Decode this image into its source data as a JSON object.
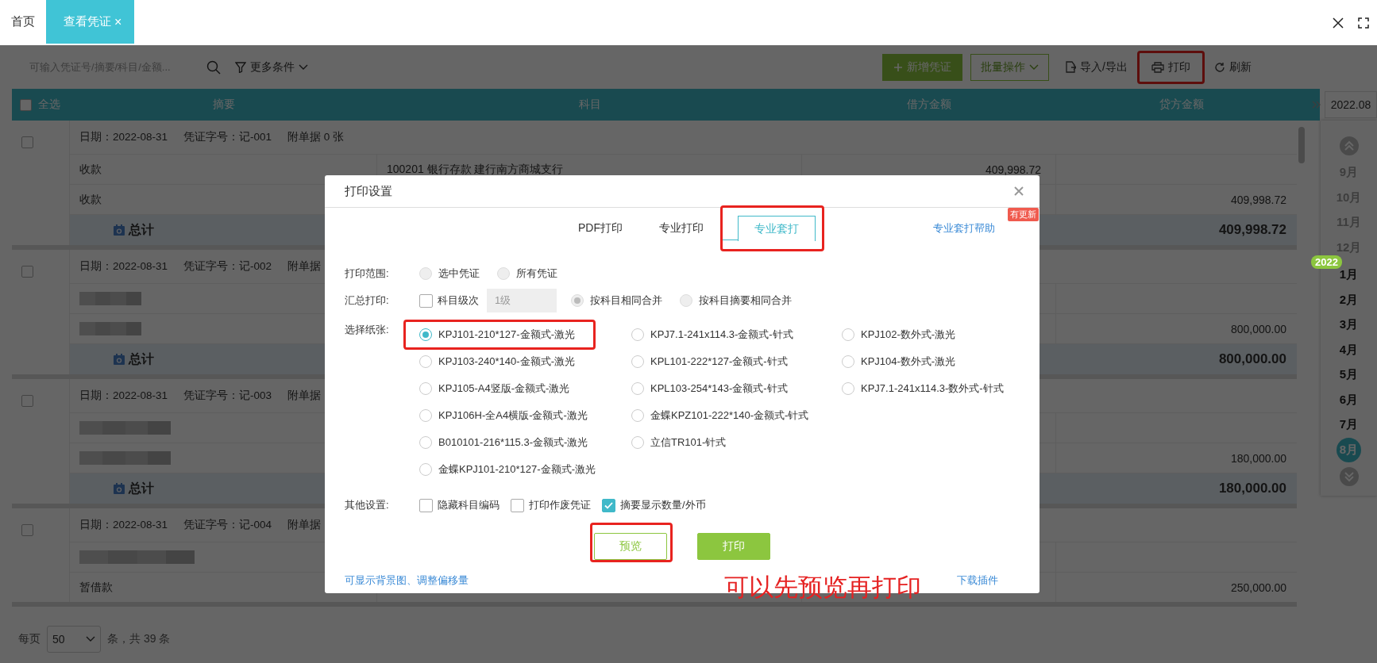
{
  "top_tabs": [
    {
      "label": "首页",
      "selected": false
    },
    {
      "label": "查看凭证",
      "selected": true,
      "close": "×"
    }
  ],
  "toolbar": {
    "search_placeholder": "可输入凭证号/摘要/科目/金额...",
    "filter": "更多条件",
    "buttons": [
      {
        "kind": "primary",
        "label": "新增凭证",
        "annotated": false
      },
      {
        "kind": "dropdown",
        "label": "批量操作",
        "annotated": false
      },
      {
        "kind": "import",
        "label": "导入/导出",
        "annotated": false
      },
      {
        "kind": "print",
        "label": "打印",
        "annotated": true
      },
      {
        "kind": "refresh",
        "label": "刷新",
        "annotated": false
      }
    ]
  },
  "table": {
    "select_all": {
      "label": "全选",
      "checked": false
    },
    "columns": [
      "摘要",
      "科目",
      "借方金额",
      "贷方金额"
    ],
    "vouchers": [
      {
        "checked": false,
        "date": "日期：2022-08-31",
        "number": "凭证字号：记-001",
        "attachments": "附单据 0 张",
        "lines": [
          {
            "kind": "text",
            "summary": "收款",
            "account": "100201 银行存款 建行南方商城支行",
            "debit": "409,998.72"
          },
          {
            "kind": "text",
            "summary": "收款",
            "credit": "409,998.72"
          }
        ],
        "total": {
          "label": "总计",
          "credit": "409,998.72"
        }
      },
      {
        "checked": false,
        "date": "日期：2022-08-31",
        "number": "凭证字号：记-002",
        "attachments": "附单据",
        "lines": [
          {
            "kind": "redacted"
          },
          {
            "kind": "redacted",
            "credit": "800,000.00"
          }
        ],
        "total": {
          "label": "总计",
          "credit": "800,000.00"
        }
      },
      {
        "checked": false,
        "date": "日期：2022-08-31",
        "number": "凭证字号：记-003",
        "attachments": "附单据",
        "lines": [
          {
            "kind": "redacted"
          },
          {
            "kind": "redacted",
            "credit": "180,000.00"
          }
        ],
        "total": {
          "label": "总计",
          "credit": "180,000.00"
        }
      },
      {
        "checked": false,
        "date": "日期：2022-08-31",
        "number": "凭证字号：记-004",
        "attachments": "附单据",
        "lines": [
          {
            "kind": "redacted"
          },
          {
            "kind": "text",
            "summary": "暂借款",
            "credit": "250,000.00"
          }
        ]
      }
    ]
  },
  "pagination": {
    "per_page_label": "每页",
    "per_page": "50",
    "count": "条，共 39 条"
  },
  "month_nav": {
    "current": "2022.08",
    "items": [
      {
        "kind": "month",
        "label": "9月",
        "selected": false,
        "muted": true
      },
      {
        "kind": "month",
        "label": "10月",
        "selected": false,
        "muted": true
      },
      {
        "kind": "month",
        "label": "11月",
        "selected": false,
        "muted": true
      },
      {
        "kind": "month",
        "label": "12月",
        "selected": false,
        "muted": true
      },
      {
        "kind": "year",
        "label": "2022"
      },
      {
        "kind": "month",
        "label": "1月",
        "selected": false,
        "muted": false
      },
      {
        "kind": "month",
        "label": "2月",
        "selected": false,
        "muted": false
      },
      {
        "kind": "month",
        "label": "3月",
        "selected": false,
        "muted": false
      },
      {
        "kind": "month",
        "label": "4月",
        "selected": false,
        "muted": false
      },
      {
        "kind": "month",
        "label": "5月",
        "selected": false,
        "muted": false
      },
      {
        "kind": "month",
        "label": "6月",
        "selected": false,
        "muted": false
      },
      {
        "kind": "month",
        "label": "7月",
        "selected": false,
        "muted": false
      },
      {
        "kind": "month",
        "label": "8月",
        "selected": true,
        "muted": false
      }
    ]
  },
  "dialog": {
    "title": "打印设置",
    "tabs": [
      {
        "label": "PDF打印",
        "selected": false,
        "annotated": false
      },
      {
        "label": "专业打印",
        "selected": false,
        "annotated": false
      },
      {
        "label": "专业套打",
        "selected": true,
        "annotated": true
      }
    ],
    "help_link": "专业套打帮助",
    "help_badge": "有更新",
    "scope": {
      "label": "打印范围:",
      "options": [
        {
          "label": "选中凭证",
          "selected": false,
          "disabled": true
        },
        {
          "label": "所有凭证",
          "selected": false,
          "disabled": true
        }
      ]
    },
    "summary": {
      "label": "汇总打印:",
      "level_check": {
        "label": "科目级次",
        "checked": false
      },
      "level_select": {
        "value": "1级",
        "disabled": true
      },
      "merge_options": [
        {
          "label": "按科目相同合并",
          "selected": true,
          "disabled": true
        },
        {
          "label": "按科目摘要相同合并",
          "selected": false,
          "disabled": true
        }
      ]
    },
    "paper": {
      "label": "选择纸张:",
      "columns": [
        [
          {
            "label": "KPJ101-210*127-金额式-激光",
            "selected": true,
            "annotated": true
          },
          {
            "label": "KPJ103-240*140-金额式-激光",
            "selected": false,
            "annotated": false
          },
          {
            "label": "KPJ105-A4竖版-金额式-激光",
            "selected": false,
            "annotated": false
          },
          {
            "label": "KPJ106H-全A4横版-金额式-激光",
            "selected": false,
            "annotated": false
          },
          {
            "label": "B010101-216*115.3-金额式-激光",
            "selected": false,
            "annotated": false
          },
          {
            "label": "金蝶KPJ101-210*127-金额式-激光",
            "selected": false,
            "annotated": false
          }
        ],
        [
          {
            "label": "KPJ7.1-241x114.3-金额式-针式",
            "selected": false,
            "annotated": false
          },
          {
            "label": "KPL101-222*127-金额式-针式",
            "selected": false,
            "annotated": false
          },
          {
            "label": "KPL103-254*143-金额式-针式",
            "selected": false,
            "annotated": false
          },
          {
            "label": "金蝶KPZ101-222*140-金额式-针式",
            "selected": false,
            "annotated": false
          },
          {
            "label": "立信TR101-针式",
            "selected": false,
            "annotated": false
          }
        ],
        [
          {
            "label": "KPJ102-数外式-激光",
            "selected": false,
            "annotated": false
          },
          {
            "label": "KPJ104-数外式-激光",
            "selected": false,
            "annotated": false
          },
          {
            "label": "KPJ7.1-241x114.3-数外式-针式",
            "selected": false,
            "annotated": false
          }
        ]
      ]
    },
    "other": {
      "label": "其他设置:",
      "options": [
        {
          "label": "隐藏科目编码",
          "checked": false
        },
        {
          "label": "打印作废凭证",
          "checked": false
        },
        {
          "label": "摘要显示数量/外币",
          "checked": true
        }
      ]
    },
    "buttons": [
      {
        "kind": "secondary",
        "label": "预览",
        "annotated": true
      },
      {
        "kind": "primary",
        "label": "打印",
        "annotated": false
      }
    ],
    "footer_link": "可显示背景图、调整偏移量",
    "download_link": "下载插件"
  },
  "annotation_note": "可以先预览再打印"
}
